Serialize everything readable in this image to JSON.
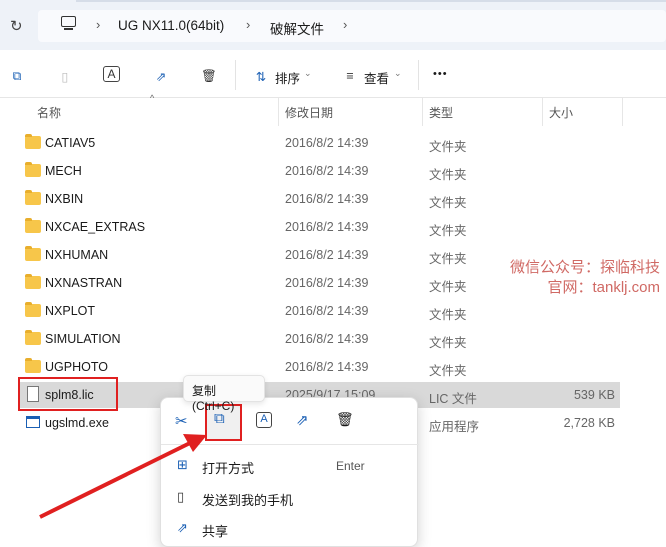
{
  "breadcrumb": {
    "items": [
      "UG NX11.0(64bit)",
      "破解文件"
    ]
  },
  "toolbar": {
    "sort_label": "排序",
    "view_label": "查看",
    "more_label": "•••"
  },
  "columns": {
    "name": "名称",
    "date": "修改日期",
    "type": "类型",
    "size": "大小"
  },
  "files": [
    {
      "name": "CATIAV5",
      "date": "2016/8/2 14:39",
      "type": "文件夹",
      "size": "",
      "kind": "folder"
    },
    {
      "name": "MECH",
      "date": "2016/8/2 14:39",
      "type": "文件夹",
      "size": "",
      "kind": "folder"
    },
    {
      "name": "NXBIN",
      "date": "2016/8/2 14:39",
      "type": "文件夹",
      "size": "",
      "kind": "folder"
    },
    {
      "name": "NXCAE_EXTRAS",
      "date": "2016/8/2 14:39",
      "type": "文件夹",
      "size": "",
      "kind": "folder"
    },
    {
      "name": "NXHUMAN",
      "date": "2016/8/2 14:39",
      "type": "文件夹",
      "size": "",
      "kind": "folder"
    },
    {
      "name": "NXNASTRAN",
      "date": "2016/8/2 14:39",
      "type": "文件夹",
      "size": "",
      "kind": "folder"
    },
    {
      "name": "NXPLOT",
      "date": "2016/8/2 14:39",
      "type": "文件夹",
      "size": "",
      "kind": "folder"
    },
    {
      "name": "SIMULATION",
      "date": "2016/8/2 14:39",
      "type": "文件夹",
      "size": "",
      "kind": "folder"
    },
    {
      "name": "UGPHOTO",
      "date": "2016/8/2 14:39",
      "type": "文件夹",
      "size": "",
      "kind": "folder"
    },
    {
      "name": "splm8.lic",
      "date": "2025/9/17 15:09",
      "type": "LIC 文件",
      "size": "539 KB",
      "kind": "file"
    },
    {
      "name": "ugslmd.exe",
      "date": "",
      "type": "应用程序",
      "size": "2,728 KB",
      "kind": "exe"
    }
  ],
  "tooltip": "复制 (Ctrl+C)",
  "context_menu": {
    "items": [
      {
        "label": "打开方式",
        "shortcut": "Enter"
      },
      {
        "label": "发送到我的手机"
      },
      {
        "label": "共享"
      }
    ]
  },
  "watermark": {
    "line1": "微信公众号：探临科技",
    "line2": "官网：tanklj.com"
  }
}
